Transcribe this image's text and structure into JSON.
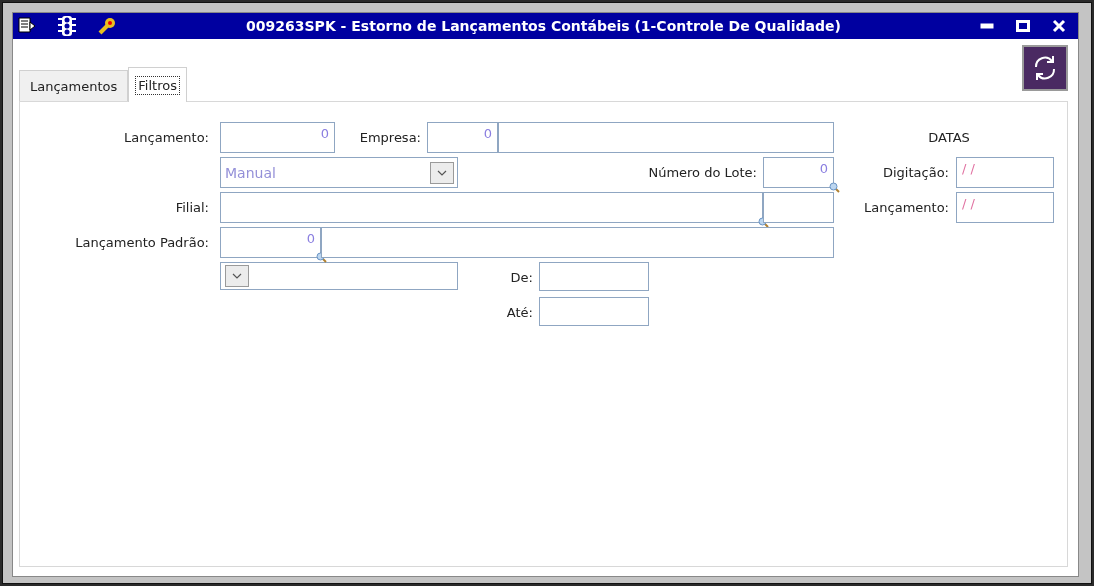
{
  "window": {
    "title": "009263SPK - Estorno de Lançamentos Contábeis (1-Controle De Qualidade)"
  },
  "tabs": [
    {
      "label": "Lançamentos",
      "selected": false
    },
    {
      "label": "Filtros",
      "selected": true
    }
  ],
  "form": {
    "lancamento": {
      "label": "Lançamento:",
      "value": "0"
    },
    "empresa": {
      "label": "Empresa:",
      "value": "0"
    },
    "tipo": {
      "value": "Manual"
    },
    "numero_lote": {
      "label": "Número do Lote:",
      "value": "0"
    },
    "filial": {
      "label": "Filial:"
    },
    "lancamento_padrao": {
      "label": "Lançamento Padrão:",
      "value": "0"
    },
    "de": {
      "label": "De:"
    },
    "ate": {
      "label": "Até:"
    }
  },
  "datas": {
    "title": "DATAS",
    "digitacao": {
      "label": "Digitação:",
      "value": "/ /"
    },
    "lancamento": {
      "label": "Lançamento:",
      "value": "/ /"
    }
  }
}
